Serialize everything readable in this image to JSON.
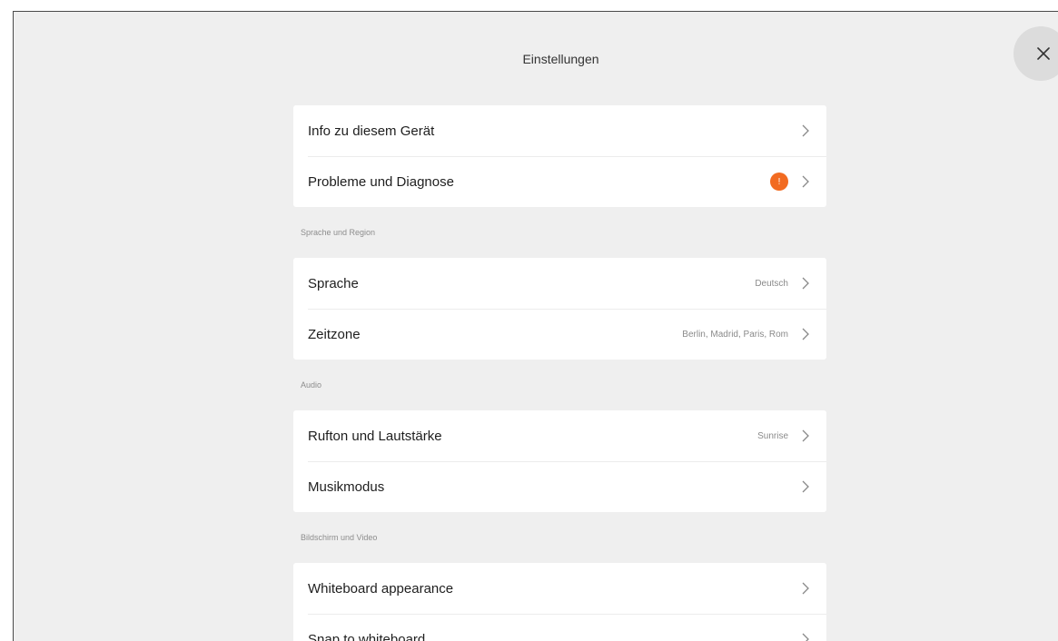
{
  "header": {
    "title": "Einstellungen"
  },
  "close_icon": "close-icon",
  "sections": [
    {
      "header": "",
      "items": [
        {
          "label": "Info zu diesem Gerät",
          "value": "",
          "badge": ""
        },
        {
          "label": "Probleme und Diagnose",
          "value": "",
          "badge": "!"
        }
      ]
    },
    {
      "header": "Sprache und Region",
      "items": [
        {
          "label": "Sprache",
          "value": "Deutsch",
          "badge": ""
        },
        {
          "label": "Zeitzone",
          "value": "Berlin, Madrid, Paris, Rom",
          "badge": ""
        }
      ]
    },
    {
      "header": "Audio",
      "items": [
        {
          "label": "Rufton und Lautstärke",
          "value": "Sunrise",
          "badge": ""
        },
        {
          "label": "Musikmodus",
          "value": "",
          "badge": ""
        }
      ]
    },
    {
      "header": "Bildschirm und Video",
      "items": [
        {
          "label": "Whiteboard appearance",
          "value": "",
          "badge": ""
        },
        {
          "label": "Snap to whiteboard",
          "value": "",
          "badge": ""
        }
      ]
    }
  ],
  "colors": {
    "background": "#efefef",
    "card": "#ffffff",
    "badge": "#f26b21",
    "close_button": "#dcdcdc"
  }
}
